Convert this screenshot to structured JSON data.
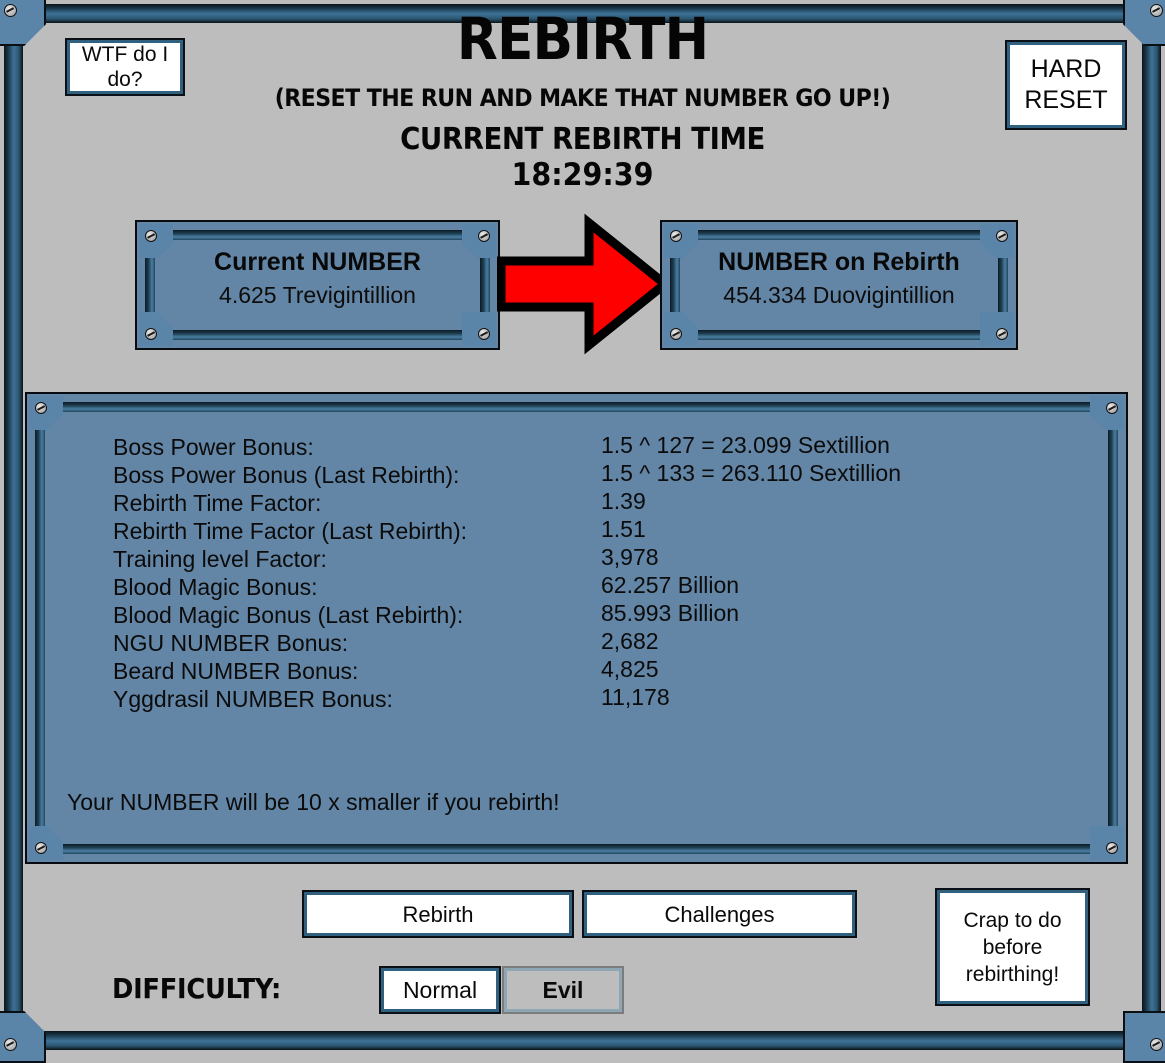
{
  "header": {
    "title": "REBIRTH",
    "subtitle": "(RESET THE RUN AND MAKE THAT NUMBER GO UP!)",
    "rebirth_time_label": "CURRENT REBIRTH TIME",
    "rebirth_time_value": "18:29:39"
  },
  "buttons": {
    "wtf": "WTF do I do?",
    "hard_reset": "HARD RESET",
    "rebirth": "Rebirth",
    "challenges": "Challenges",
    "crap_to_do": "Crap to do before rebirthing!"
  },
  "difficulty": {
    "label": "DIFFICULTY:",
    "options": [
      {
        "name": "Normal",
        "selected": false
      },
      {
        "name": "Evil",
        "selected": true
      }
    ]
  },
  "number_panels": [
    {
      "title": "Current NUMBER",
      "value": "4.625 Trevigintillion"
    },
    {
      "title": "NUMBER on Rebirth",
      "value": "454.334 Duovigintillion"
    }
  ],
  "arrow": {
    "icon": "right-arrow-icon",
    "color": "#ff0000",
    "outline": "#000000"
  },
  "stats": [
    {
      "label": "Boss Power Bonus:",
      "value": "1.5 ^ 127 = 23.099 Sextillion"
    },
    {
      "label": "Boss Power Bonus (Last Rebirth):",
      "value": "1.5 ^ 133 = 263.110 Sextillion"
    },
    {
      "label": "Rebirth Time Factor:",
      "value": "1.39"
    },
    {
      "label": "Rebirth Time Factor (Last Rebirth):",
      "value": "1.51"
    },
    {
      "label": "Training level Factor:",
      "value": "3,978"
    },
    {
      "label": "Blood Magic Bonus:",
      "value": "62.257 Billion"
    },
    {
      "label": "Blood Magic Bonus (Last Rebirth):",
      "value": "85.993 Billion"
    },
    {
      "label": "NGU NUMBER Bonus:",
      "value": "2,682"
    },
    {
      "label": "Beard NUMBER Bonus:",
      "value": "4,825"
    },
    {
      "label": "Yggdrasil NUMBER Bonus:",
      "value": "11,178"
    }
  ],
  "stats_note": "Your NUMBER will be 10 x smaller if you rebirth!",
  "colors": {
    "background": "#bdbdbd",
    "panel_fill": "#6386a6",
    "frame_dark": "#0b1016",
    "frame_blue": "#3f7296",
    "accent_red": "#ff0000"
  }
}
